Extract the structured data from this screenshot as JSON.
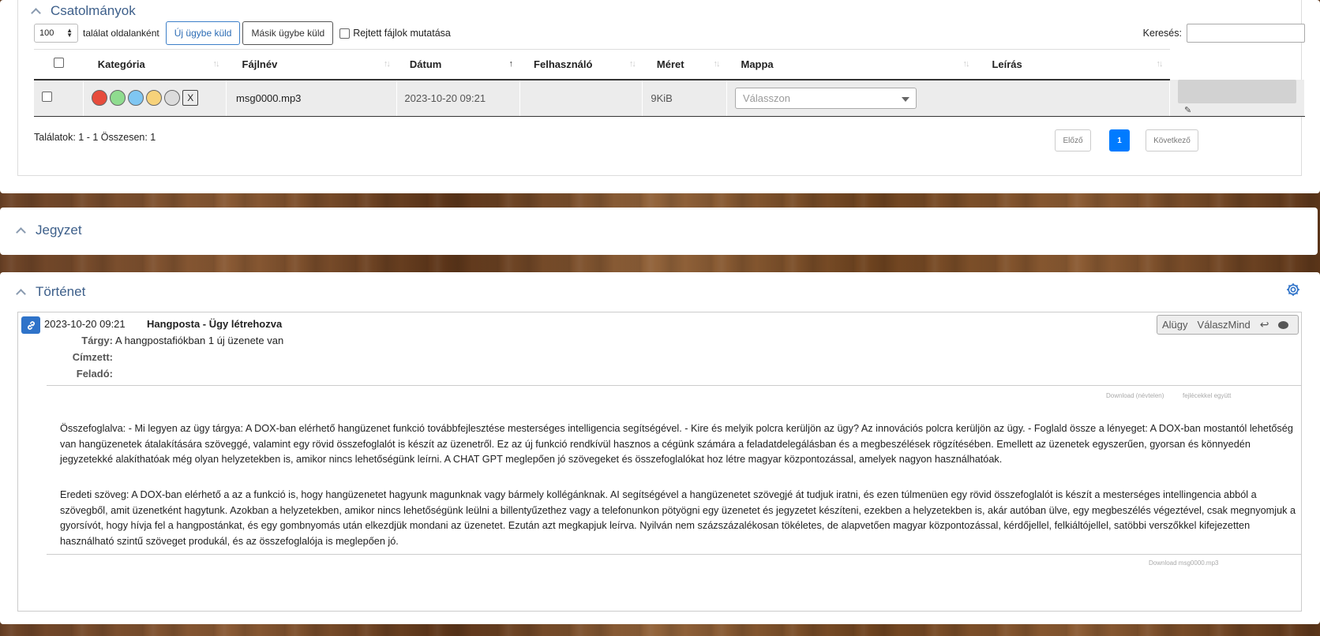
{
  "attachments": {
    "title": "Csatolmányok",
    "per_page": "100",
    "per_page_suffix": "találat oldalanként",
    "send_new_case": "Új ügybe küld",
    "send_other_case": "Másik ügybe küld",
    "show_hidden": "Rejtett fájlok mutatása",
    "search_label": "Keresés:",
    "search_value": "",
    "columns": [
      "Kategória",
      "Fájlnév",
      "Dátum",
      "Felhasználó",
      "Méret",
      "Mappa",
      "Leírás"
    ],
    "sort_icons": {
      "default": "up-down-arrows-icon",
      "active": "sort-ascending-icon",
      "active_column": "Dátum"
    },
    "rows": [
      {
        "category_colors": [
          "#e74c3c",
          "#8fdc8f",
          "#7fc6f2",
          "#f7d27a",
          "#dcdcdc"
        ],
        "category_clear": "X",
        "filename": "msg0000.mp3",
        "date": "2023-10-20 09:21",
        "user": "",
        "size": "9KiB",
        "folder_placeholder": "Válasszon",
        "edit_icon": "pencil-icon"
      }
    ],
    "results_text": "Találatok: 1 - 1 Összesen: 1",
    "pager": {
      "prev": "Előző",
      "page": "1",
      "next": "Következő"
    },
    "accent": "#007bff"
  },
  "note": {
    "title": "Jegyzet"
  },
  "history": {
    "title": "Történet",
    "settings_icon": "gear-icon",
    "entry": {
      "link_icon": "link-icon",
      "date": "2023-10-20 09:21",
      "title": "Hangposta - Ügy létrehozva",
      "subject_label": "Tárgy:",
      "subject": "A hangpostafiókban 1 új üzenete van",
      "recipient_label": "Címzett:",
      "sender_label": "Feladó:",
      "actions": {
        "subcase": "Alügy",
        "reply_all": "VálaszMind",
        "reply_icon": "reply-icon",
        "comment_icon": "comment-icon"
      },
      "download_named": "Download (névtelen)",
      "download_with_headers": "fejlécekkel együtt",
      "summary": "Összefoglalva: - Mi legyen az ügy tárgya: A DOX-ban elérhető hangüzenet funkció továbbfejlesztése mesterséges intelligencia segítségével. - Kire és melyik polcra kerüljön az ügy? Az innovációs polcra kerüljön az ügy. - Foglald össze a lényeget: A DOX-ban mostantól lehetőség van hangüzenetek átalakítására szöveggé, valamint egy rövid összefoglalót is készít az üzenetről. Ez az új funkció rendkívül hasznos a cégünk számára a feladatdelegálásban és a megbeszélések rögzítésében. Emellett az üzenetek egyszerűen, gyorsan és könnyedén jegyzetekké alakíthatóak még olyan helyzetekben is, amikor nincs lehetőségünk leírni. A CHAT GPT meglepően jó szövegeket és összefoglalókat hoz létre magyar központozással, amelyek nagyon használhatóak.",
      "original": "Eredeti szöveg: A DOX-ban elérhető a az a funkció is, hogy hangüzenetet hagyunk magunknak vagy bármely kollégánknak. AI segítségével a hangüzenetet szövegjé át tudjuk iratni, és ezen túlmenüen egy rövid összefoglalót is készít a mesterséges intellingencia abból a szövegből, amit üzenetként hagytunk. Azokban a helyzetekben, amikor nincs lehetőségünk leülni a billentyűzethez vagy a telefonunkon pötyögni egy üzenetet és jegyzetet készíteni, ezekben a helyzetekben is, akár autóban ülve, egy megbeszélés végeztével, csak megnyomjuk a gyorsívót, hogy hívja fel a hangpostánkat, és egy gombnyomás után elkezdjük mondani az üzenetet. Ezután azt megkapjuk leírva. Nyilván nem százszázalékosan tökéletes, de alapvetően magyar központozással, kérdőjellel, felkiáltójellel, satöbbi verszőkkel kifejezetten használható szintű szöveget produkál, és az összefoglalója is meglepően jó.",
      "download_file": "Download msg0000.mp3"
    }
  }
}
